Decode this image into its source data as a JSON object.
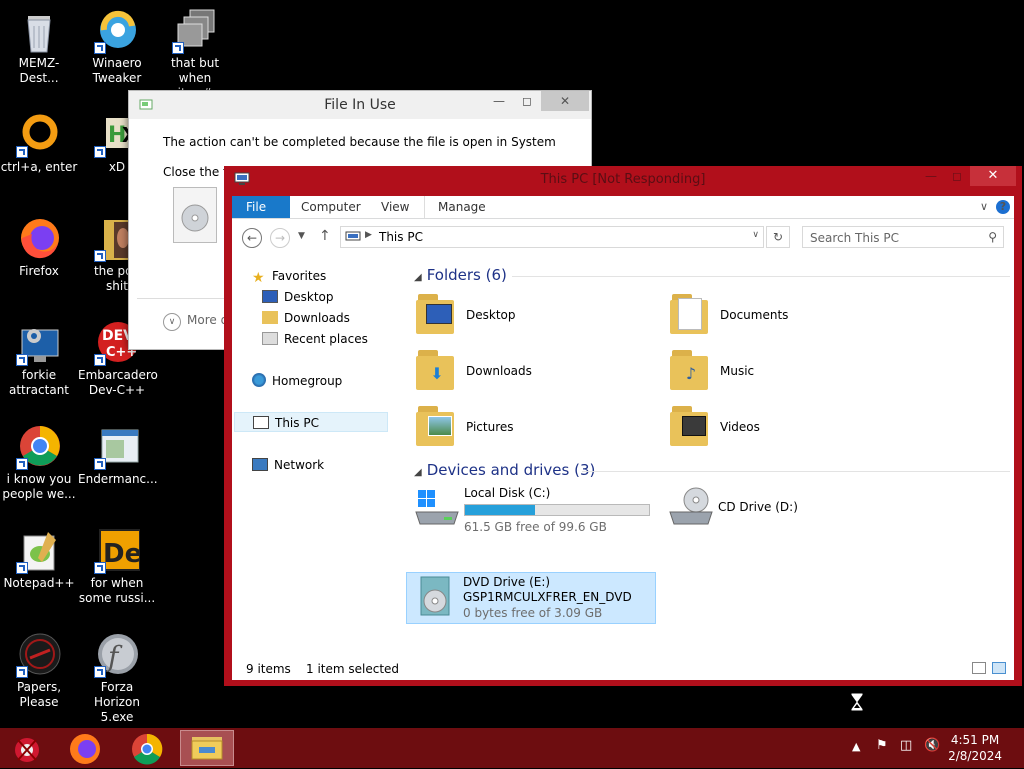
{
  "desktop_icons": [
    {
      "label": "MEMZ-Dest...",
      "icon": "recycle-bin-icon"
    },
    {
      "label": "Winaero\nTweaker",
      "icon": "winaero-tweaker-icon"
    },
    {
      "label": "that but when\nits c#",
      "icon": "stacked-windows-icon"
    },
    {
      "label": "ctrl+a, enter",
      "icon": "orange-ring-icon"
    },
    {
      "label": "xD",
      "icon": "hex-editor-icon"
    },
    {
      "label": "Firefox",
      "icon": "firefox-icon"
    },
    {
      "label": "the pop\nshit",
      "icon": "folder-book-icon"
    },
    {
      "label": "forkie\nattractant",
      "icon": "gear-monitor-icon"
    },
    {
      "label": "Embarcadero\nDev-C++",
      "icon": "devcpp-icon"
    },
    {
      "label": "i know you\npeople we...",
      "icon": "chrome-icon"
    },
    {
      "label": "Endermanc...",
      "icon": "app-window-icon"
    },
    {
      "label": "Notepad++",
      "icon": "notepadpp-icon"
    },
    {
      "label": "for when\nsome russi...",
      "icon": "de-app-icon"
    },
    {
      "label": "Papers, Please",
      "icon": "papers-please-icon"
    },
    {
      "label": "Forza Horizon\n5.exe",
      "icon": "flash-icon"
    }
  ],
  "file_in_use": {
    "title": "File In Use",
    "message": "The action can't be completed because the file is open in System",
    "message2": "Close the fil",
    "more": "More d"
  },
  "explorer": {
    "title": "This PC [Not Responding]",
    "ribbon_tabs": [
      "File",
      "Computer",
      "View",
      "Manage"
    ],
    "address": "This PC",
    "search_placeholder": "Search This PC",
    "nav": {
      "favorites": "Favorites",
      "desktop": "Desktop",
      "downloads": "Downloads",
      "recent": "Recent places",
      "homegroup": "Homegroup",
      "thispc": "This PC",
      "network": "Network"
    },
    "folders_header": "Folders (6)",
    "folders": [
      "Desktop",
      "Documents",
      "Downloads",
      "Music",
      "Pictures",
      "Videos"
    ],
    "drives_header": "Devices and drives (3)",
    "drives": [
      {
        "name": "Local Disk (C:)",
        "free": "61.5 GB free of 99.6 GB",
        "used_fraction": 0.383
      },
      {
        "name": "CD Drive (D:)"
      },
      {
        "name": "DVD Drive (E:)",
        "label": "GSP1RMCULXFRER_EN_DVD",
        "free": "0 bytes free of 3.09 GB"
      }
    ],
    "status_items": "9 items",
    "status_selected": "1 item selected"
  },
  "taskbar": {
    "time": "4:51 PM",
    "date": "2/8/2024"
  },
  "colors": {
    "window_frame": "#b10f1b",
    "taskbar": "#6d0d10",
    "file_tab": "#1979ca",
    "group_header": "#1e3287"
  }
}
